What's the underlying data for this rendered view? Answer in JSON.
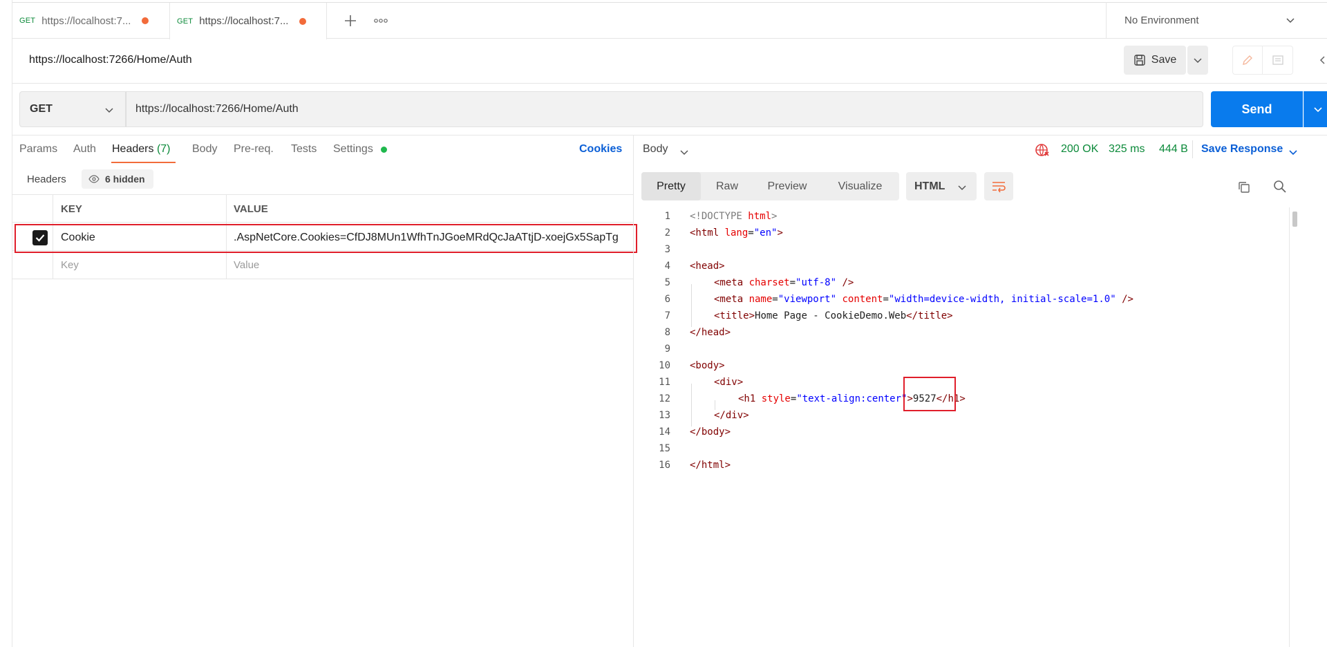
{
  "tabs": [
    {
      "method": "GET",
      "title": "https://localhost:7..."
    },
    {
      "method": "GET",
      "title": "https://localhost:7..."
    }
  ],
  "environment": {
    "label": "No Environment"
  },
  "request": {
    "title": "https://localhost:7266/Home/Auth",
    "method": "GET",
    "url": "https://localhost:7266/Home/Auth",
    "save_label": "Save",
    "send_label": "Send"
  },
  "request_tabs": {
    "params": "Params",
    "auth": "Auth",
    "headers": "Headers",
    "headers_count": "(7)",
    "body": "Body",
    "prereq": "Pre-req.",
    "tests": "Tests",
    "settings": "Settings",
    "cookies": "Cookies"
  },
  "headers_section": {
    "label": "Headers",
    "hidden": "6 hidden",
    "col_key": "KEY",
    "col_value": "VALUE",
    "rows": [
      {
        "key": "Cookie",
        "value": ".AspNetCore.Cookies=CfDJ8MUn1WfhTnJGoeMRdQcJaATtjD-xoejGx5SapTg",
        "checked": true
      }
    ],
    "placeholder_key": "Key",
    "placeholder_value": "Value"
  },
  "response": {
    "body_label": "Body",
    "status": "200 OK",
    "time": "325 ms",
    "size": "444 B",
    "save_response": "Save Response",
    "views": [
      "Pretty",
      "Raw",
      "Preview",
      "Visualize"
    ],
    "format": "HTML"
  },
  "code_lines": [
    "1",
    "2",
    "3",
    "4",
    "5",
    "6",
    "7",
    "8",
    "9",
    "10",
    "11",
    "12",
    "13",
    "14",
    "15",
    "16"
  ],
  "code": {
    "l1_a": "<!DOCTYPE ",
    "l1_b": "html",
    "l1_c": ">",
    "l2_a": "<html ",
    "l2_b": "lang",
    "l2_c": "=",
    "l2_d": "\"en\"",
    "l2_e": ">",
    "l4": "<head>",
    "l5_a": "<meta ",
    "l5_b": "charset",
    "l5_c": "=",
    "l5_d": "\"utf-8\"",
    "l5_e": " />",
    "l6_a": "<meta ",
    "l6_b": "name",
    "l6_c": "=",
    "l6_d": "\"viewport\"",
    "l6_e": " content",
    "l6_f": "=",
    "l6_g": "\"width=device-width, initial-scale=1.0\"",
    "l6_h": " />",
    "l7_a": "<title>",
    "l7_b": "Home Page - CookieDemo.Web",
    "l7_c": "</title>",
    "l8": "</head>",
    "l10": "<body>",
    "l11": "<div>",
    "l12_a": "<h1 ",
    "l12_b": "style",
    "l12_c": "=",
    "l12_d": "\"text-align:center\"",
    "l12_e": ">",
    "l12_f": "9527",
    "l12_g": "</h1>",
    "l13": "</div>",
    "l14": "</body>",
    "l16": "</html>"
  },
  "colors": {
    "accent": "#097bed",
    "success": "#0c8a3a",
    "tab_dot": "#f26b3a",
    "highlight": "#e01e2a"
  }
}
